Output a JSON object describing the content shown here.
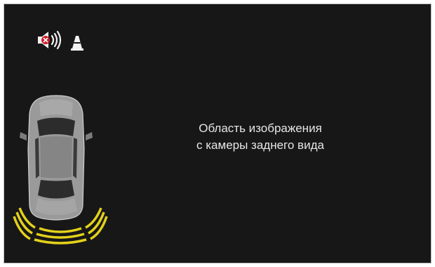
{
  "screen": {
    "background_color": "#171717",
    "mute_button": {
      "icon": "speaker-muted-icon",
      "state": "muted"
    },
    "obstacle_button": {
      "icon": "traffic-cone-icon"
    },
    "camera_area": {
      "line1": "Область изображения",
      "line2": "с камеры заднего вида"
    },
    "parking_sensor": {
      "icon": "car-top-view-icon",
      "rear_zone_color": "#e3d21a",
      "rear_arc_count": 3
    }
  }
}
